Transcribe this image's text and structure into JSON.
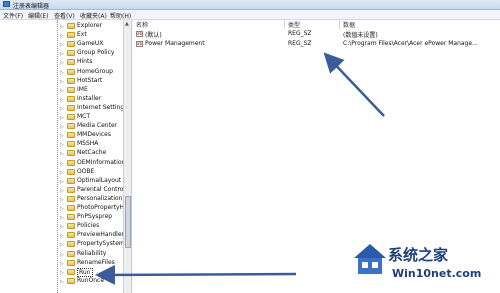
{
  "window": {
    "title": "注册表编辑器"
  },
  "menu": [
    "文件(F)",
    "编辑(E)",
    "查看(V)",
    "收藏夹(A)",
    "帮助(H)"
  ],
  "tree": {
    "items": [
      {
        "label": "Explorer"
      },
      {
        "label": "Ext"
      },
      {
        "label": "GameUX"
      },
      {
        "label": "Group Policy"
      },
      {
        "label": "Hints"
      },
      {
        "label": "HomeGroup"
      },
      {
        "label": "HotStart"
      },
      {
        "label": "IME"
      },
      {
        "label": "Installer"
      },
      {
        "label": "Internet Settings"
      },
      {
        "label": "MCT"
      },
      {
        "label": "Media Center"
      },
      {
        "label": "MMDevices"
      },
      {
        "label": "MSSHA"
      },
      {
        "label": "NetCache"
      },
      {
        "label": "OEMInformation"
      },
      {
        "label": "OOBE"
      },
      {
        "label": "OptimalLayout"
      },
      {
        "label": "Parental Controls"
      },
      {
        "label": "Personalization"
      },
      {
        "label": "PhotoPropertyHar"
      },
      {
        "label": "PnPSysprep"
      },
      {
        "label": "Policies"
      },
      {
        "label": "PreviewHandlers"
      },
      {
        "label": "PropertySystem"
      },
      {
        "label": "Reliability"
      },
      {
        "label": "RenameFiles"
      },
      {
        "label": "Run"
      },
      {
        "label": "RunOnce"
      }
    ],
    "selected": "Run"
  },
  "columns": {
    "name": "名称",
    "type": "类型",
    "data": "数据"
  },
  "values": [
    {
      "name": "(默认)",
      "type": "REG_SZ",
      "data": "(数值未设置)"
    },
    {
      "name": "Power Management",
      "type": "REG_SZ",
      "data": "C:\\Program Files\\Acer\\Acer ePower Manage..."
    }
  ],
  "icon_names": [
    "registry-app-icon",
    "folder-icon",
    "string-value-icon"
  ],
  "watermark": {
    "name": "系统之家",
    "url": "Win10net.com"
  },
  "colors": {
    "arrow": "#3a5d9a",
    "folder": "#e8c866",
    "watermark": "#1f3f7a"
  }
}
